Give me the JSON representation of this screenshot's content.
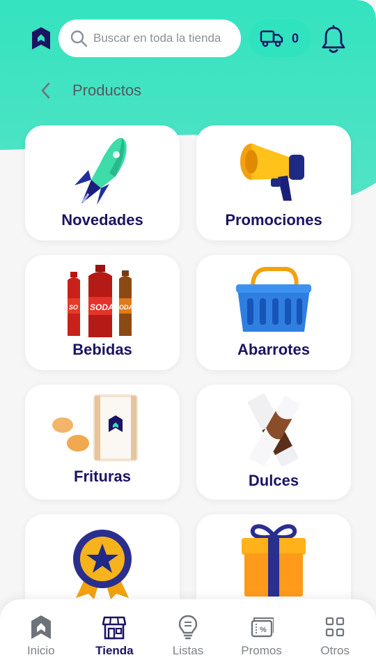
{
  "header": {
    "search_placeholder": "Buscar en toda la tienda",
    "cart_count": "0"
  },
  "breadcrumb": {
    "title": "Productos"
  },
  "categories": [
    {
      "label": "Novedades",
      "icon": "rocket-icon"
    },
    {
      "label": "Promociones",
      "icon": "megaphone-icon"
    },
    {
      "label": "Bebidas",
      "icon": "soda-bottles-icon"
    },
    {
      "label": "Abarrotes",
      "icon": "basket-icon"
    },
    {
      "label": "Frituras",
      "icon": "chips-bag-icon"
    },
    {
      "label": "Dulces",
      "icon": "chocolate-bar-icon"
    },
    {
      "label": "",
      "icon": "star-badge-icon"
    },
    {
      "label": "",
      "icon": "gift-box-icon"
    }
  ],
  "bottom_nav": [
    {
      "label": "Inicio",
      "icon": "home-icon",
      "active": false
    },
    {
      "label": "Tienda",
      "icon": "store-icon",
      "active": true
    },
    {
      "label": "Listas",
      "icon": "lightbulb-icon",
      "active": false
    },
    {
      "label": "Promos",
      "icon": "coupon-icon",
      "active": false
    },
    {
      "label": "Otros",
      "icon": "grid-icon",
      "active": false
    }
  ],
  "colors": {
    "brand_teal": "#2fe3bf",
    "brand_navy": "#1a1463"
  }
}
